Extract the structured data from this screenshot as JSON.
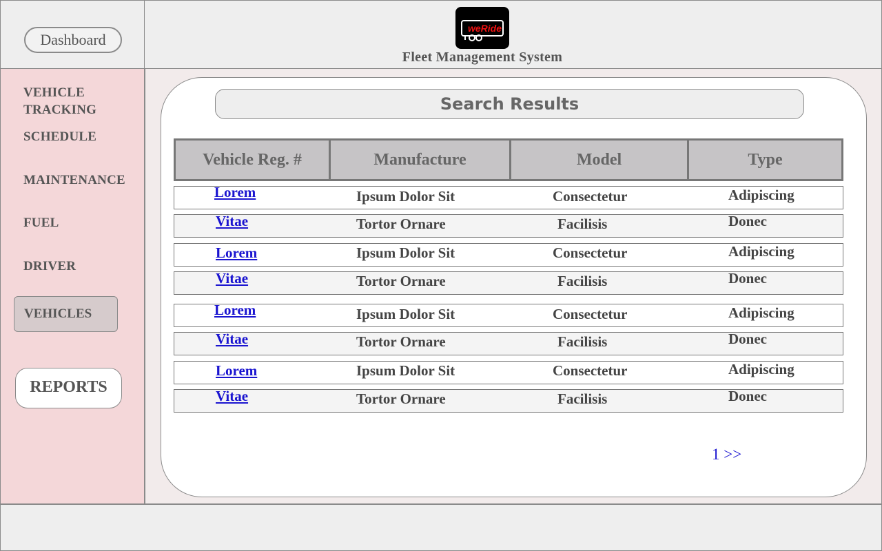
{
  "dashboard_button": {
    "label": "Dashboard"
  },
  "header": {
    "title": "Fleet Management System",
    "logo_text": "weRide"
  },
  "sidebar": {
    "items": [
      {
        "label": "VEHICLE\nTRACKING"
      },
      {
        "label": "SCHEDULE"
      },
      {
        "label": "MAINTENANCE"
      },
      {
        "label": "FUEL"
      },
      {
        "label": "DRIVER"
      },
      {
        "label": "VEHICLES",
        "selected": true
      },
      {
        "label": "REPORTS"
      }
    ]
  },
  "results": {
    "title": "Search Results",
    "columns": [
      "Vehicle Reg. #",
      "Manufacture",
      "Model",
      "Type"
    ],
    "rows": [
      [
        "Lorem",
        "Ipsum Dolor Sit",
        "Consectetur",
        "Adipiscing"
      ],
      [
        "Vitae",
        "Tortor Ornare",
        "Facilisis",
        "Donec"
      ],
      [
        "Lorem",
        "Ipsum Dolor Sit",
        "Consectetur",
        "Adipiscing"
      ],
      [
        "Vitae",
        "Tortor Ornare",
        "Facilisis",
        "Donec"
      ],
      [
        "Lorem",
        "Ipsum Dolor Sit",
        "Consectetur",
        "Adipiscing"
      ],
      [
        "Vitae",
        "Tortor Ornare",
        "Facilisis",
        "Donec"
      ],
      [
        "Lorem",
        "Ipsum Dolor Sit",
        "Consectetur",
        "Adipiscing"
      ],
      [
        "Vitae",
        "Tortor Ornare",
        "Facilisis",
        "Donec"
      ]
    ]
  },
  "pagination": {
    "page": "1",
    "next": ">>"
  },
  "colors": {
    "sidebar_bg": "#f4d7d9",
    "link": "#1a14d0",
    "header_bg": "#eeeeee"
  }
}
